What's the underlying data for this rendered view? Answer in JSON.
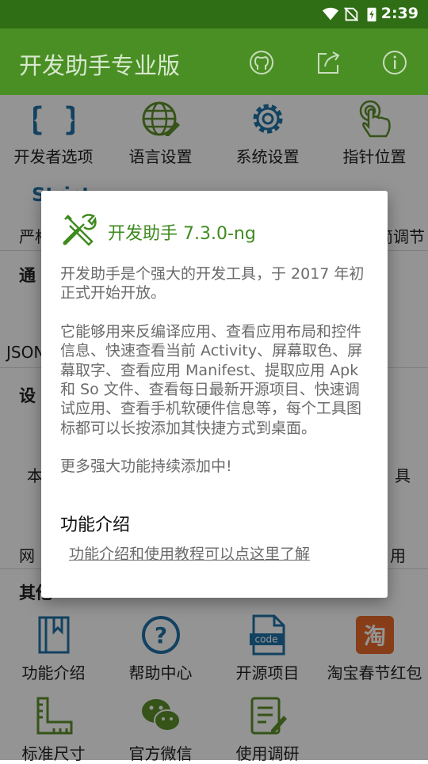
{
  "status_bar": {
    "time": "2:39",
    "icons": [
      "wifi-icon",
      "no-sim-icon",
      "battery-charging-icon"
    ]
  },
  "app_bar": {
    "title": "开发助手专业版",
    "actions": [
      "github-icon",
      "share-icon",
      "info-icon"
    ]
  },
  "colors": {
    "appbar": "#4a8f24",
    "statusbar": "#2f6e14",
    "accent_green": "#3f8a1f",
    "icon_blue": "#1f73a8",
    "icon_green": "#5e8f2a",
    "taobao_orange": "#e8692a"
  },
  "row1": [
    {
      "label": "开发者选项",
      "icon": "braces-icon"
    },
    {
      "label": "语言设置",
      "icon": "globe-edit-icon"
    },
    {
      "label": "系统设置",
      "icon": "gear-icon"
    },
    {
      "label": "指针位置",
      "icon": "touch-pointer-icon"
    }
  ],
  "row2_fragments": {
    "left": "严格",
    "right": "简调节",
    "partial_label": "Strict"
  },
  "sections": {
    "tools_head": "通",
    "tools_fragment": "JSON",
    "settings_head": "设",
    "settings_left": "本",
    "settings_right": "具",
    "network_left": "网",
    "network_right": "用",
    "others_head": "其他"
  },
  "row_bottom1": [
    {
      "label": "功能介绍",
      "icon": "book-icon"
    },
    {
      "label": "帮助中心",
      "icon": "question-icon"
    },
    {
      "label": "开源项目",
      "icon": "code-file-icon"
    },
    {
      "label": "淘宝春节红包",
      "icon": "taobao-icon"
    }
  ],
  "row_bottom2": [
    {
      "label": "标准尺寸",
      "icon": "ruler-icon"
    },
    {
      "label": "官方微信",
      "icon": "wechat-icon"
    },
    {
      "label": "使用调研",
      "icon": "survey-icon"
    }
  ],
  "dialog": {
    "title": "开发助手 7.3.0-ng",
    "icon": "tools-icon",
    "paragraph1": "开发助手是个强大的开发工具，于 2017 年初正式开始开放。",
    "paragraph2": "它能够用来反编译应用、查看应用布局和控件信息、快速查看当前 Activity、屏幕取色、屏幕取字、查看应用 Manifest、提取应用 Apk 和 So 文件、查看每日最新开源项目、快速调试应用、查看手机软硬件信息等，每个工具图标都可以长按添加其快捷方式到桌面。",
    "paragraph3": "更多强大功能持续添加中!",
    "subtitle": "功能介绍",
    "link": "功能介绍和使用教程可以点这里了解"
  }
}
